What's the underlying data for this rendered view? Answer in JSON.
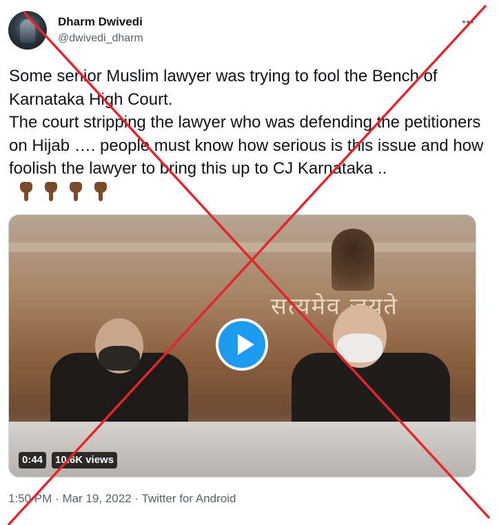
{
  "author": {
    "name": "Dharm Dwivedi",
    "handle": "@dwivedi_dharm"
  },
  "more_icon": "⋯",
  "tweet": {
    "lines": [
      "Some senior Muslim lawyer was trying to fool the Bench of Karnataka High Court.",
      "The court stripping the lawyer who was defending the petitioners on Hijab …. people must know how serious is this issue and how foolish the lawyer to bring this up to CJ Karnataka .."
    ],
    "emojis": [
      "backhand-index-pointing-down",
      "backhand-index-pointing-down",
      "backhand-index-pointing-down",
      "backhand-index-pointing-down"
    ]
  },
  "media": {
    "motto_text": "सत्यमेव जयते",
    "duration": "0:44",
    "views": "10.6K views"
  },
  "footer": {
    "time": "1:50 PM",
    "date": "Mar 19, 2022",
    "source": "Twitter for Android"
  },
  "colors": {
    "accent": "#1d9bf0",
    "overlay_cross": "#e3262b",
    "muted_text": "#536471"
  }
}
